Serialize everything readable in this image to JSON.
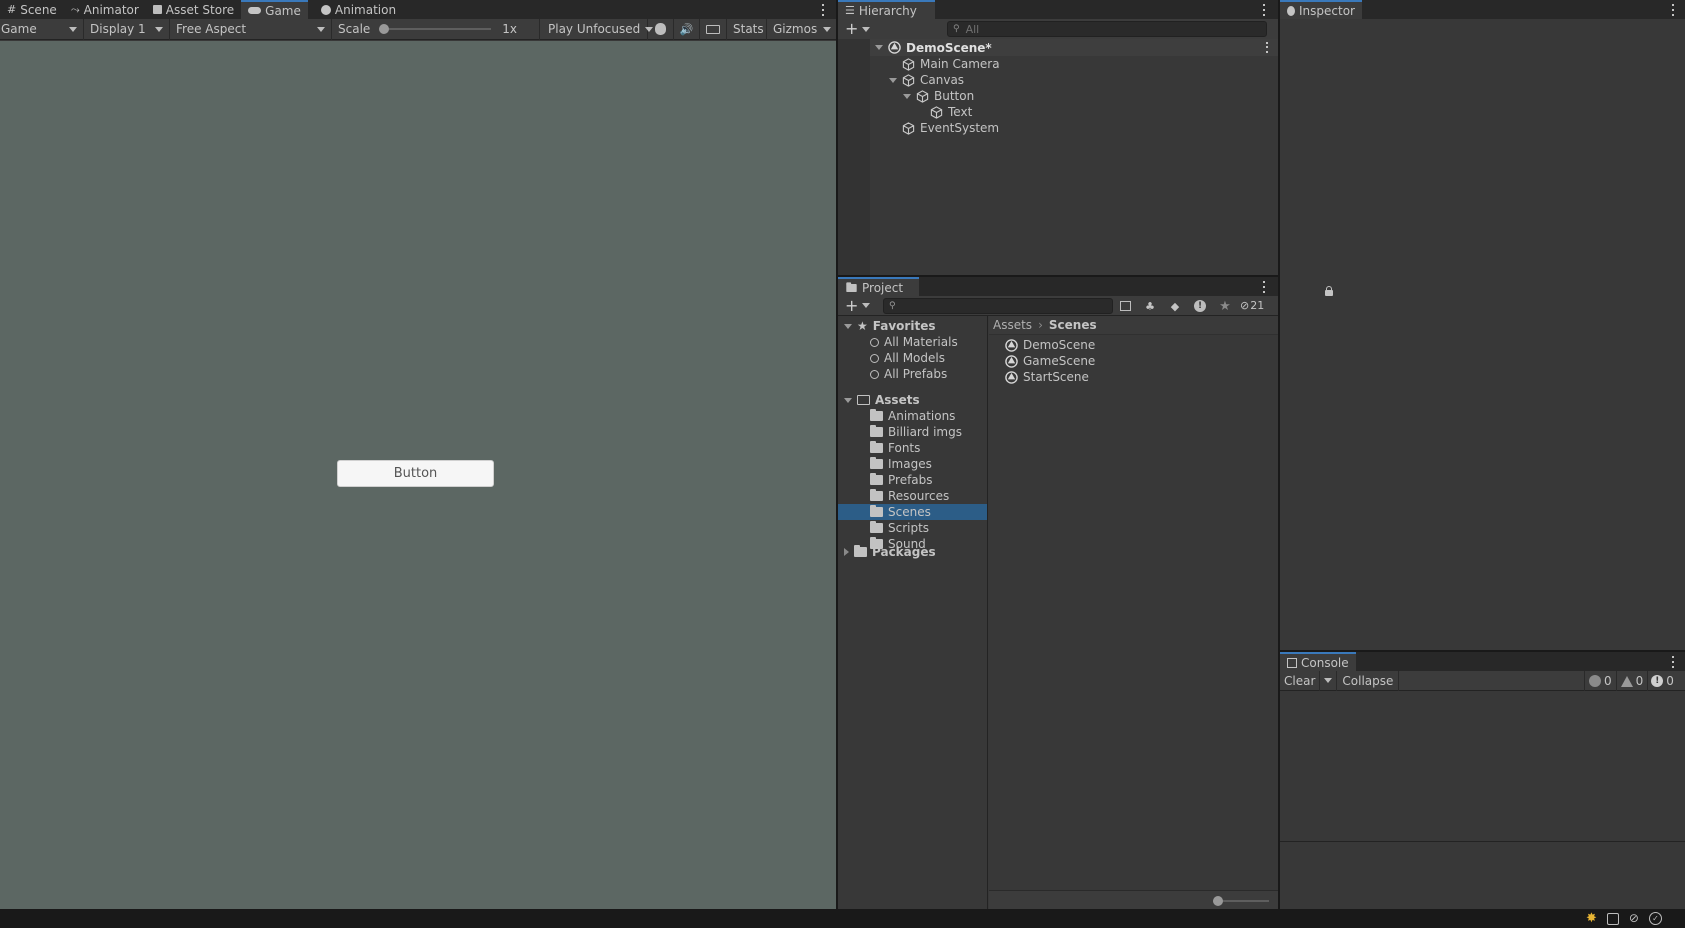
{
  "game_panel": {
    "tabs": [
      {
        "label": "Scene",
        "icon": "scene-grid-icon"
      },
      {
        "label": "Animator",
        "icon": "animator-icon"
      },
      {
        "label": "Asset Store",
        "icon": "asset-store-bag-icon"
      },
      {
        "label": "Game",
        "icon": "game-controller-icon"
      },
      {
        "label": "Animation",
        "icon": "animation-clock-icon"
      }
    ],
    "active_tab": "Game",
    "toolbar": {
      "view_select": "Game",
      "display_select": "Display 1",
      "aspect_select": "Free Aspect",
      "scale_label": "Scale",
      "scale_value": "1x",
      "scale_fraction": 0.0,
      "play_mode_select": "Play Unfocused",
      "stats_label": "Stats",
      "gizmos_label": "Gizmos"
    },
    "viewport_bg": "#5c6763",
    "button_label": "Button"
  },
  "hierarchy": {
    "title": "Hierarchy",
    "search_placeholder": "All",
    "scene_name": "DemoScene*",
    "items": [
      {
        "label": "Main Camera",
        "depth": 1,
        "expandable": false
      },
      {
        "label": "Canvas",
        "depth": 1,
        "expandable": true
      },
      {
        "label": "Button",
        "depth": 2,
        "expandable": true
      },
      {
        "label": "Text",
        "depth": 3,
        "expandable": false
      },
      {
        "label": "EventSystem",
        "depth": 1,
        "expandable": false
      }
    ]
  },
  "inspector": {
    "title": "Inspector"
  },
  "project": {
    "title": "Project",
    "hidden_count": "21",
    "favorites_label": "Favorites",
    "favorites": [
      "All Materials",
      "All Models",
      "All Prefabs"
    ],
    "assets_label": "Assets",
    "asset_folders": [
      "Animations",
      "Billiard imgs",
      "Fonts",
      "Images",
      "Prefabs",
      "Resources",
      "Scenes",
      "Scripts",
      "Sound"
    ],
    "selected_folder": "Scenes",
    "packages_label": "Packages",
    "breadcrumb": [
      "Assets",
      "Scenes"
    ],
    "files": [
      "DemoScene",
      "GameScene",
      "StartScene"
    ]
  },
  "console": {
    "title": "Console",
    "clear_label": "Clear",
    "collapse_label": "Collapse",
    "info_count": "0",
    "warning_count": "0",
    "error_count": "0"
  },
  "colors": {
    "accent": "#3a79bb",
    "selection": "#2c5d87",
    "panel": "#383838"
  }
}
